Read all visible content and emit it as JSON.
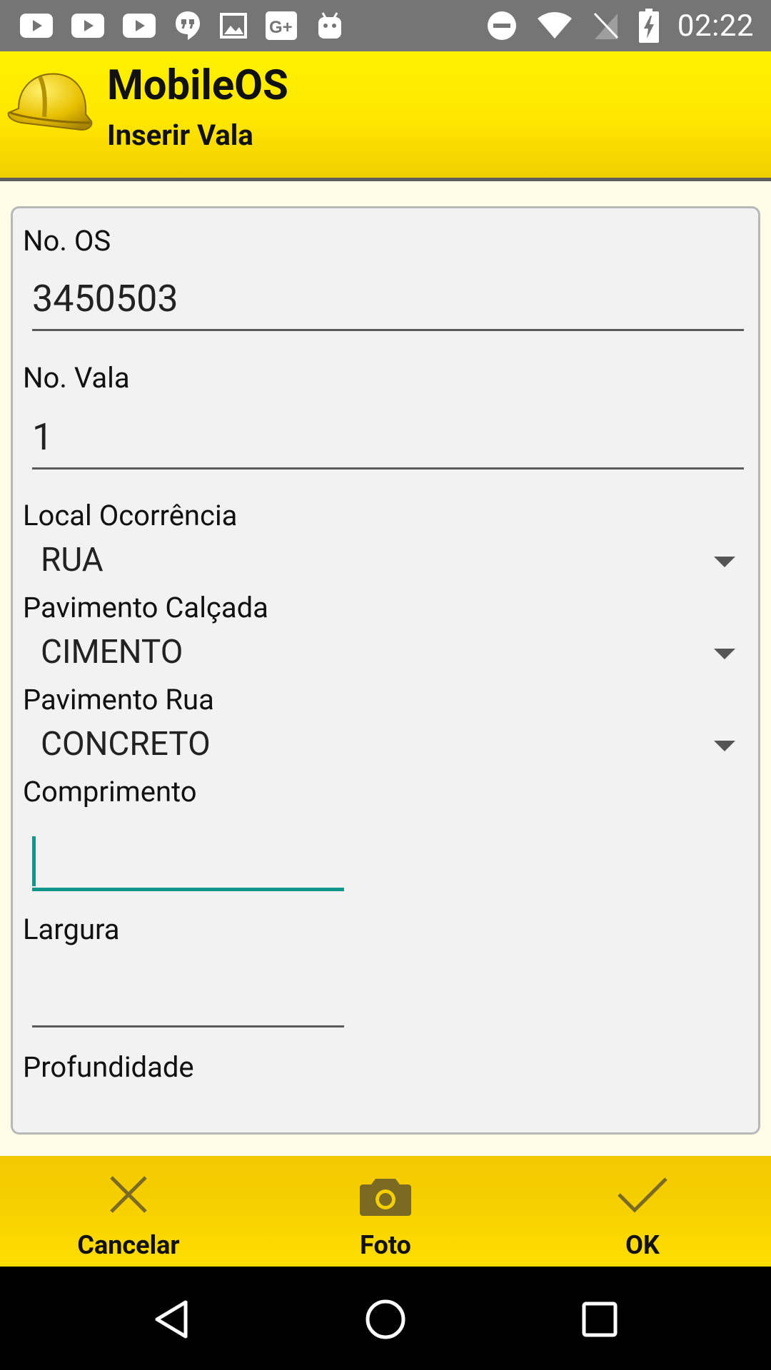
{
  "status_bar": {
    "time": "02:22",
    "left_icons": [
      "youtube-icon",
      "youtube-icon",
      "youtube-icon",
      "hangouts-icon",
      "image-icon",
      "google-plus-icon",
      "android-icon"
    ],
    "right_icons": [
      "do-not-disturb-icon",
      "wifi-icon",
      "no-sim-icon",
      "battery-charging-icon"
    ]
  },
  "header": {
    "title": "MobileOS",
    "subtitle": "Inserir Vala"
  },
  "form": {
    "no_os_label": "No. OS",
    "no_os_value": "3450503",
    "no_vala_label": "No. Vala",
    "no_vala_value": "1",
    "local_label": "Local Ocorrência",
    "local_value": "RUA",
    "pav_calcada_label": "Pavimento Calçada",
    "pav_calcada_value": "CIMENTO",
    "pav_rua_label": "Pavimento Rua",
    "pav_rua_value": "CONCRETO",
    "comprimento_label": "Comprimento",
    "comprimento_value": "",
    "largura_label": "Largura",
    "largura_value": "",
    "profundidade_label": "Profundidade"
  },
  "actions": {
    "cancel_label": "Cancelar",
    "photo_label": "Foto",
    "ok_label": "OK"
  },
  "colors": {
    "header_yellow": "#ffe600",
    "accent_teal": "#12968a",
    "action_bar_yellow": "#f5cf00",
    "icon_olive": "#7a6a22"
  }
}
